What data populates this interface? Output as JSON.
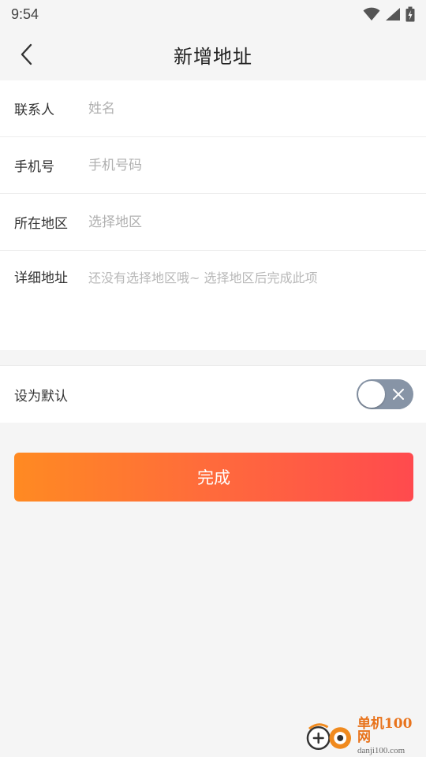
{
  "status_bar": {
    "time": "9:54"
  },
  "nav": {
    "title": "新增地址"
  },
  "form": {
    "contact": {
      "label": "联系人",
      "placeholder": "姓名",
      "value": ""
    },
    "phone": {
      "label": "手机号",
      "placeholder": "手机号码",
      "value": ""
    },
    "region": {
      "label": "所在地区",
      "placeholder": "选择地区",
      "value": ""
    },
    "detail": {
      "label": "详细地址",
      "placeholder": "还没有选择地区哦~ 选择地区后完成此项",
      "value": ""
    }
  },
  "default_setting": {
    "label": "设为默认",
    "enabled": false
  },
  "submit": {
    "label": "完成"
  },
  "watermark": {
    "name_cn": "单机100网",
    "domain": "danji100.com"
  },
  "colors": {
    "accent_start": "#ff8a22",
    "accent_end": "#ff4a4e",
    "toggle_off": "#8794a6",
    "background": "#f5f5f5"
  }
}
